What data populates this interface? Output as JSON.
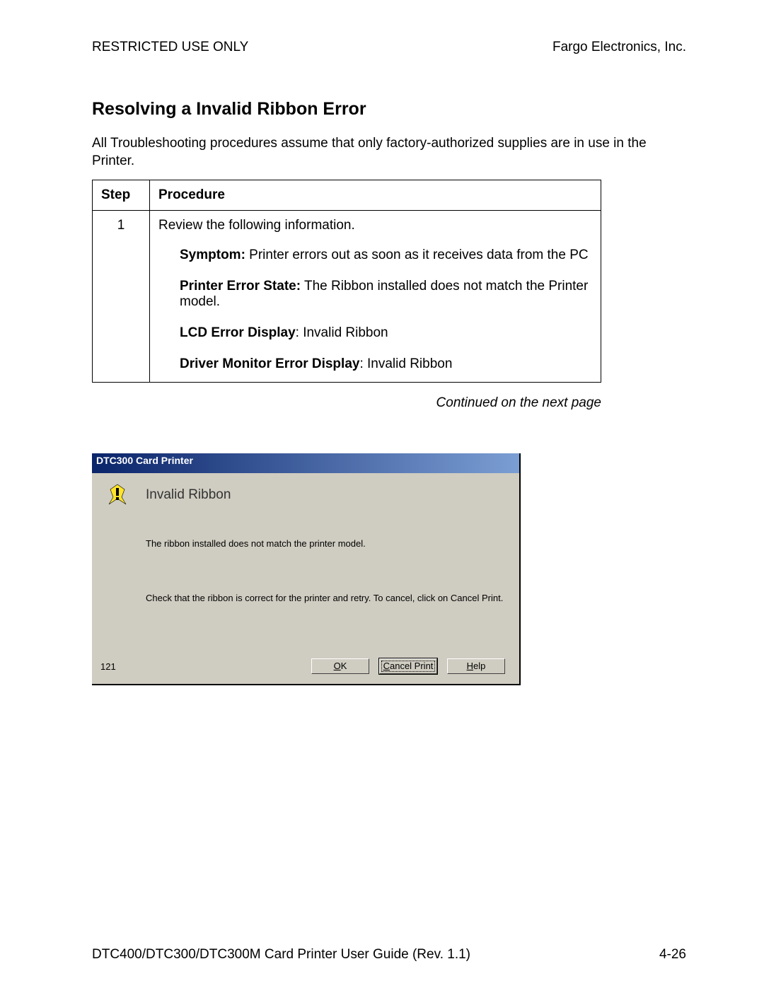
{
  "header": {
    "left": "RESTRICTED USE ONLY",
    "right": "Fargo Electronics, Inc."
  },
  "title": "Resolving a Invalid Ribbon Error",
  "intro": "All Troubleshooting procedures assume that only factory-authorized supplies are in use in the Printer.",
  "table": {
    "col_step": "Step",
    "col_procedure": "Procedure",
    "row1": {
      "step": "1",
      "lead": "Review the following information.",
      "symptom_label": "Symptom:",
      "symptom_text": " Printer errors out as soon as it receives data from the PC",
      "state_label": "Printer Error State:",
      "state_text": " The Ribbon installed does not match the Printer model.",
      "lcd_label": "LCD Error Display",
      "lcd_text": ": Invalid Ribbon",
      "drv_label": "Driver Monitor Error Display",
      "drv_text": ": Invalid Ribbon"
    }
  },
  "continued": "Continued on the next page",
  "dialog": {
    "title": "DTC300 Card Printer",
    "heading": "Invalid Ribbon",
    "msg1": "The ribbon installed does not match the printer model.",
    "msg2": "Check that the ribbon is correct for the printer and retry. To cancel, click on Cancel Print.",
    "code": "121",
    "ok_u": "O",
    "ok_rest": "K",
    "cancel_u": "C",
    "cancel_rest": "ancel Print",
    "help_u": "H",
    "help_rest": "elp"
  },
  "footer": {
    "left": "DTC400/DTC300/DTC300M Card Printer User Guide (Rev. 1.1)",
    "right": "4-26"
  }
}
